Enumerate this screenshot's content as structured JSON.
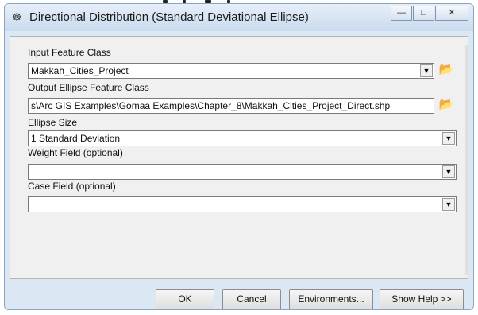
{
  "window": {
    "title": "Directional Distribution (Standard Deviational Ellipse)",
    "title_icon": "tool-icon"
  },
  "fields": [
    {
      "label": "Input Feature Class",
      "value": "Makkah_Cities_Project",
      "kind": "combo",
      "browse": true
    },
    {
      "label": "Output Ellipse Feature Class",
      "value": "s\\Arc GIS Examples\\Gomaa Examples\\Chapter_8\\Makkah_Cities_Project_Direct.shp",
      "kind": "text",
      "browse": true
    },
    {
      "label": "Ellipse Size",
      "value": "1 Standard Deviation",
      "kind": "combo",
      "browse": false
    },
    {
      "label": "Weight Field (optional)",
      "value": "",
      "kind": "combo",
      "browse": false
    },
    {
      "label": "Case Field (optional)",
      "value": "",
      "kind": "combo",
      "browse": false
    }
  ],
  "buttons": {
    "ok": "OK",
    "cancel": "Cancel",
    "environments": "Environments...",
    "show_help": "Show Help >>"
  },
  "colors": {
    "browse_icon": "#c79a1e",
    "titlebar": "#c9dbee"
  }
}
